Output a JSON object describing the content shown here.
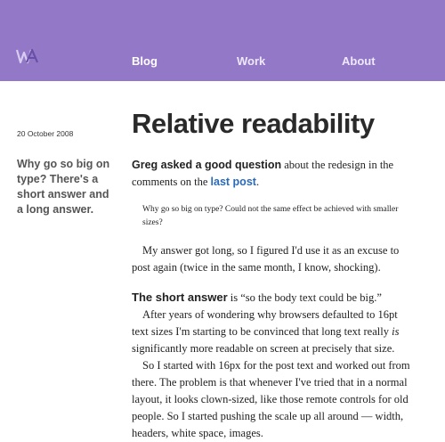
{
  "header": {
    "logo_text": "WA",
    "nav": [
      {
        "label": "Blog"
      },
      {
        "label": "Work"
      },
      {
        "label": "About"
      }
    ],
    "bg_color": "#9378c8"
  },
  "sidebar": {
    "date": "20 October 2008",
    "summary": "Why go so big on type? There's a short answer and a long answer."
  },
  "post": {
    "title": "Relative readability",
    "intro_lead": "Greg asked a good question",
    "intro_rest": " about the redesign in the comments on the ",
    "intro_link": "last post",
    "intro_end": ".",
    "quote": "Why go so big on type? Could not the same effect be achieved with smaller sizes?",
    "para1": "My answer got long, so I figured I'd use it as an excuse to post again (twice in the same month, I know, shocking).",
    "subhead": "The short answer",
    "subhead_rest": " is “so the body text could be big.”",
    "para2_a": "After years of wondering why browsers defaulted to 16pt text sizes I'm starting to be convinced that long text really ",
    "para2_em": "is",
    "para2_b": " significantly more readable on screen at precisely that size.",
    "para3": "So I started with 16px for the post text and worked out from there. The problem is that whenever I've tried that in a normal layout, it looks clown-sized, like those remote controls for old people. So I started pushing the scale up all around — width, headers, white space, images."
  }
}
